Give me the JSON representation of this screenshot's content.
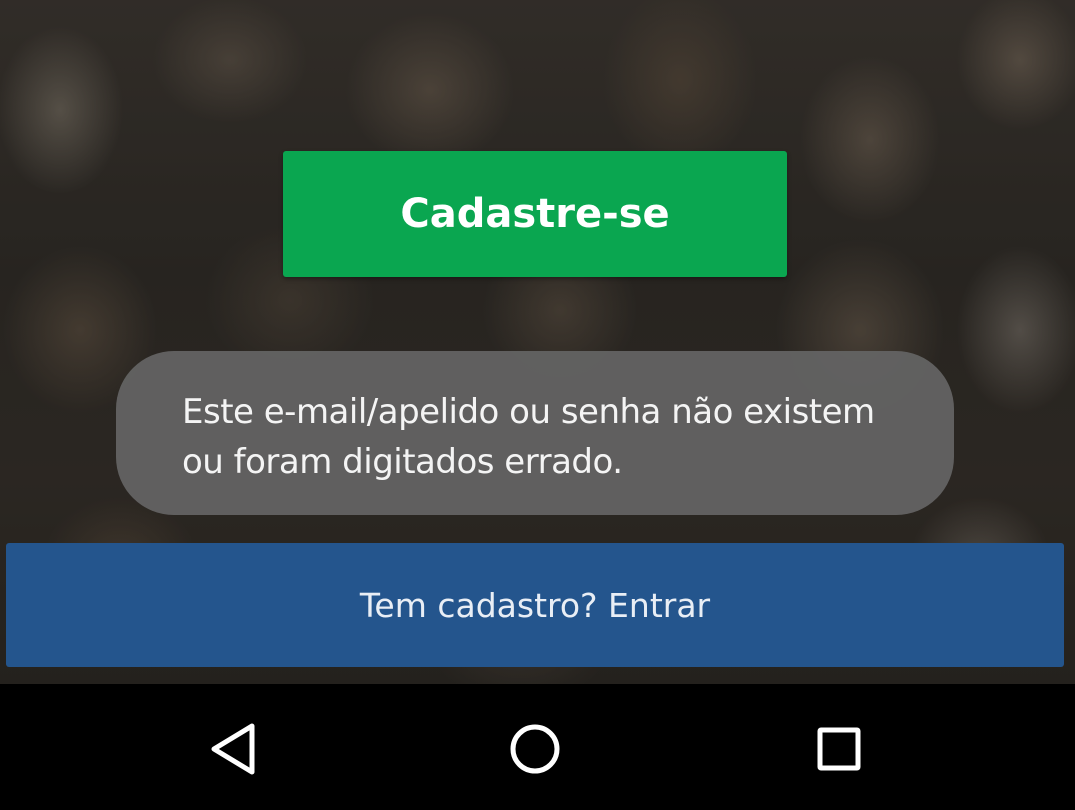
{
  "background": {
    "icon": "blurred-photo-mosaic"
  },
  "signup": {
    "label": "Cadastre-se",
    "color": "#0aa650"
  },
  "toast": {
    "line1": "Este e-mail/apelido ou senha não existem",
    "line2": "ou foram digitados errado."
  },
  "login": {
    "label": "Tem cadastro? Entrar",
    "color": "#24558d"
  },
  "navbar": {
    "back_icon": "back-triangle-icon",
    "home_icon": "home-circle-icon",
    "recents_icon": "recents-square-icon"
  }
}
